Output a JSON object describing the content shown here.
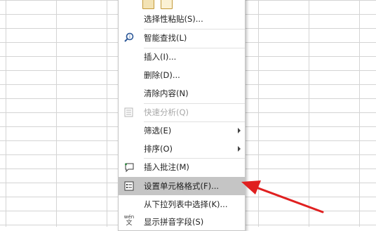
{
  "menu": {
    "items": [
      {
        "label": "选择性粘贴(S)...",
        "icon": "none",
        "disabled": false
      },
      {
        "label": "智能查找(L)",
        "icon": "smart-lookup-icon",
        "disabled": false
      },
      {
        "label": "插入(I)...",
        "icon": "none",
        "disabled": false
      },
      {
        "label": "删除(D)...",
        "icon": "none",
        "disabled": false
      },
      {
        "label": "清除内容(N)",
        "icon": "none",
        "disabled": false
      },
      {
        "label": "快速分析(Q)",
        "icon": "quick-analysis-icon",
        "disabled": true
      },
      {
        "label": "筛选(E)",
        "icon": "none",
        "disabled": false,
        "submenu": true
      },
      {
        "label": "排序(O)",
        "icon": "none",
        "disabled": false,
        "submenu": true
      },
      {
        "label": "插入批注(M)",
        "icon": "comment-icon",
        "disabled": false
      },
      {
        "label": "设置单元格格式(F)...",
        "icon": "format-cells-icon",
        "disabled": false,
        "highlighted": true
      },
      {
        "label": "从下拉列表中选择(K)...",
        "icon": "none",
        "disabled": false
      },
      {
        "label": "显示拼音字段(S)",
        "icon": "phonetic-icon",
        "disabled": false
      }
    ],
    "phonetic_icon_text": {
      "top": "wén",
      "bottom": "文"
    }
  },
  "colors": {
    "highlight": "#c5c5c5",
    "arrow": "#e02020",
    "grid": "#d4d4d4"
  }
}
